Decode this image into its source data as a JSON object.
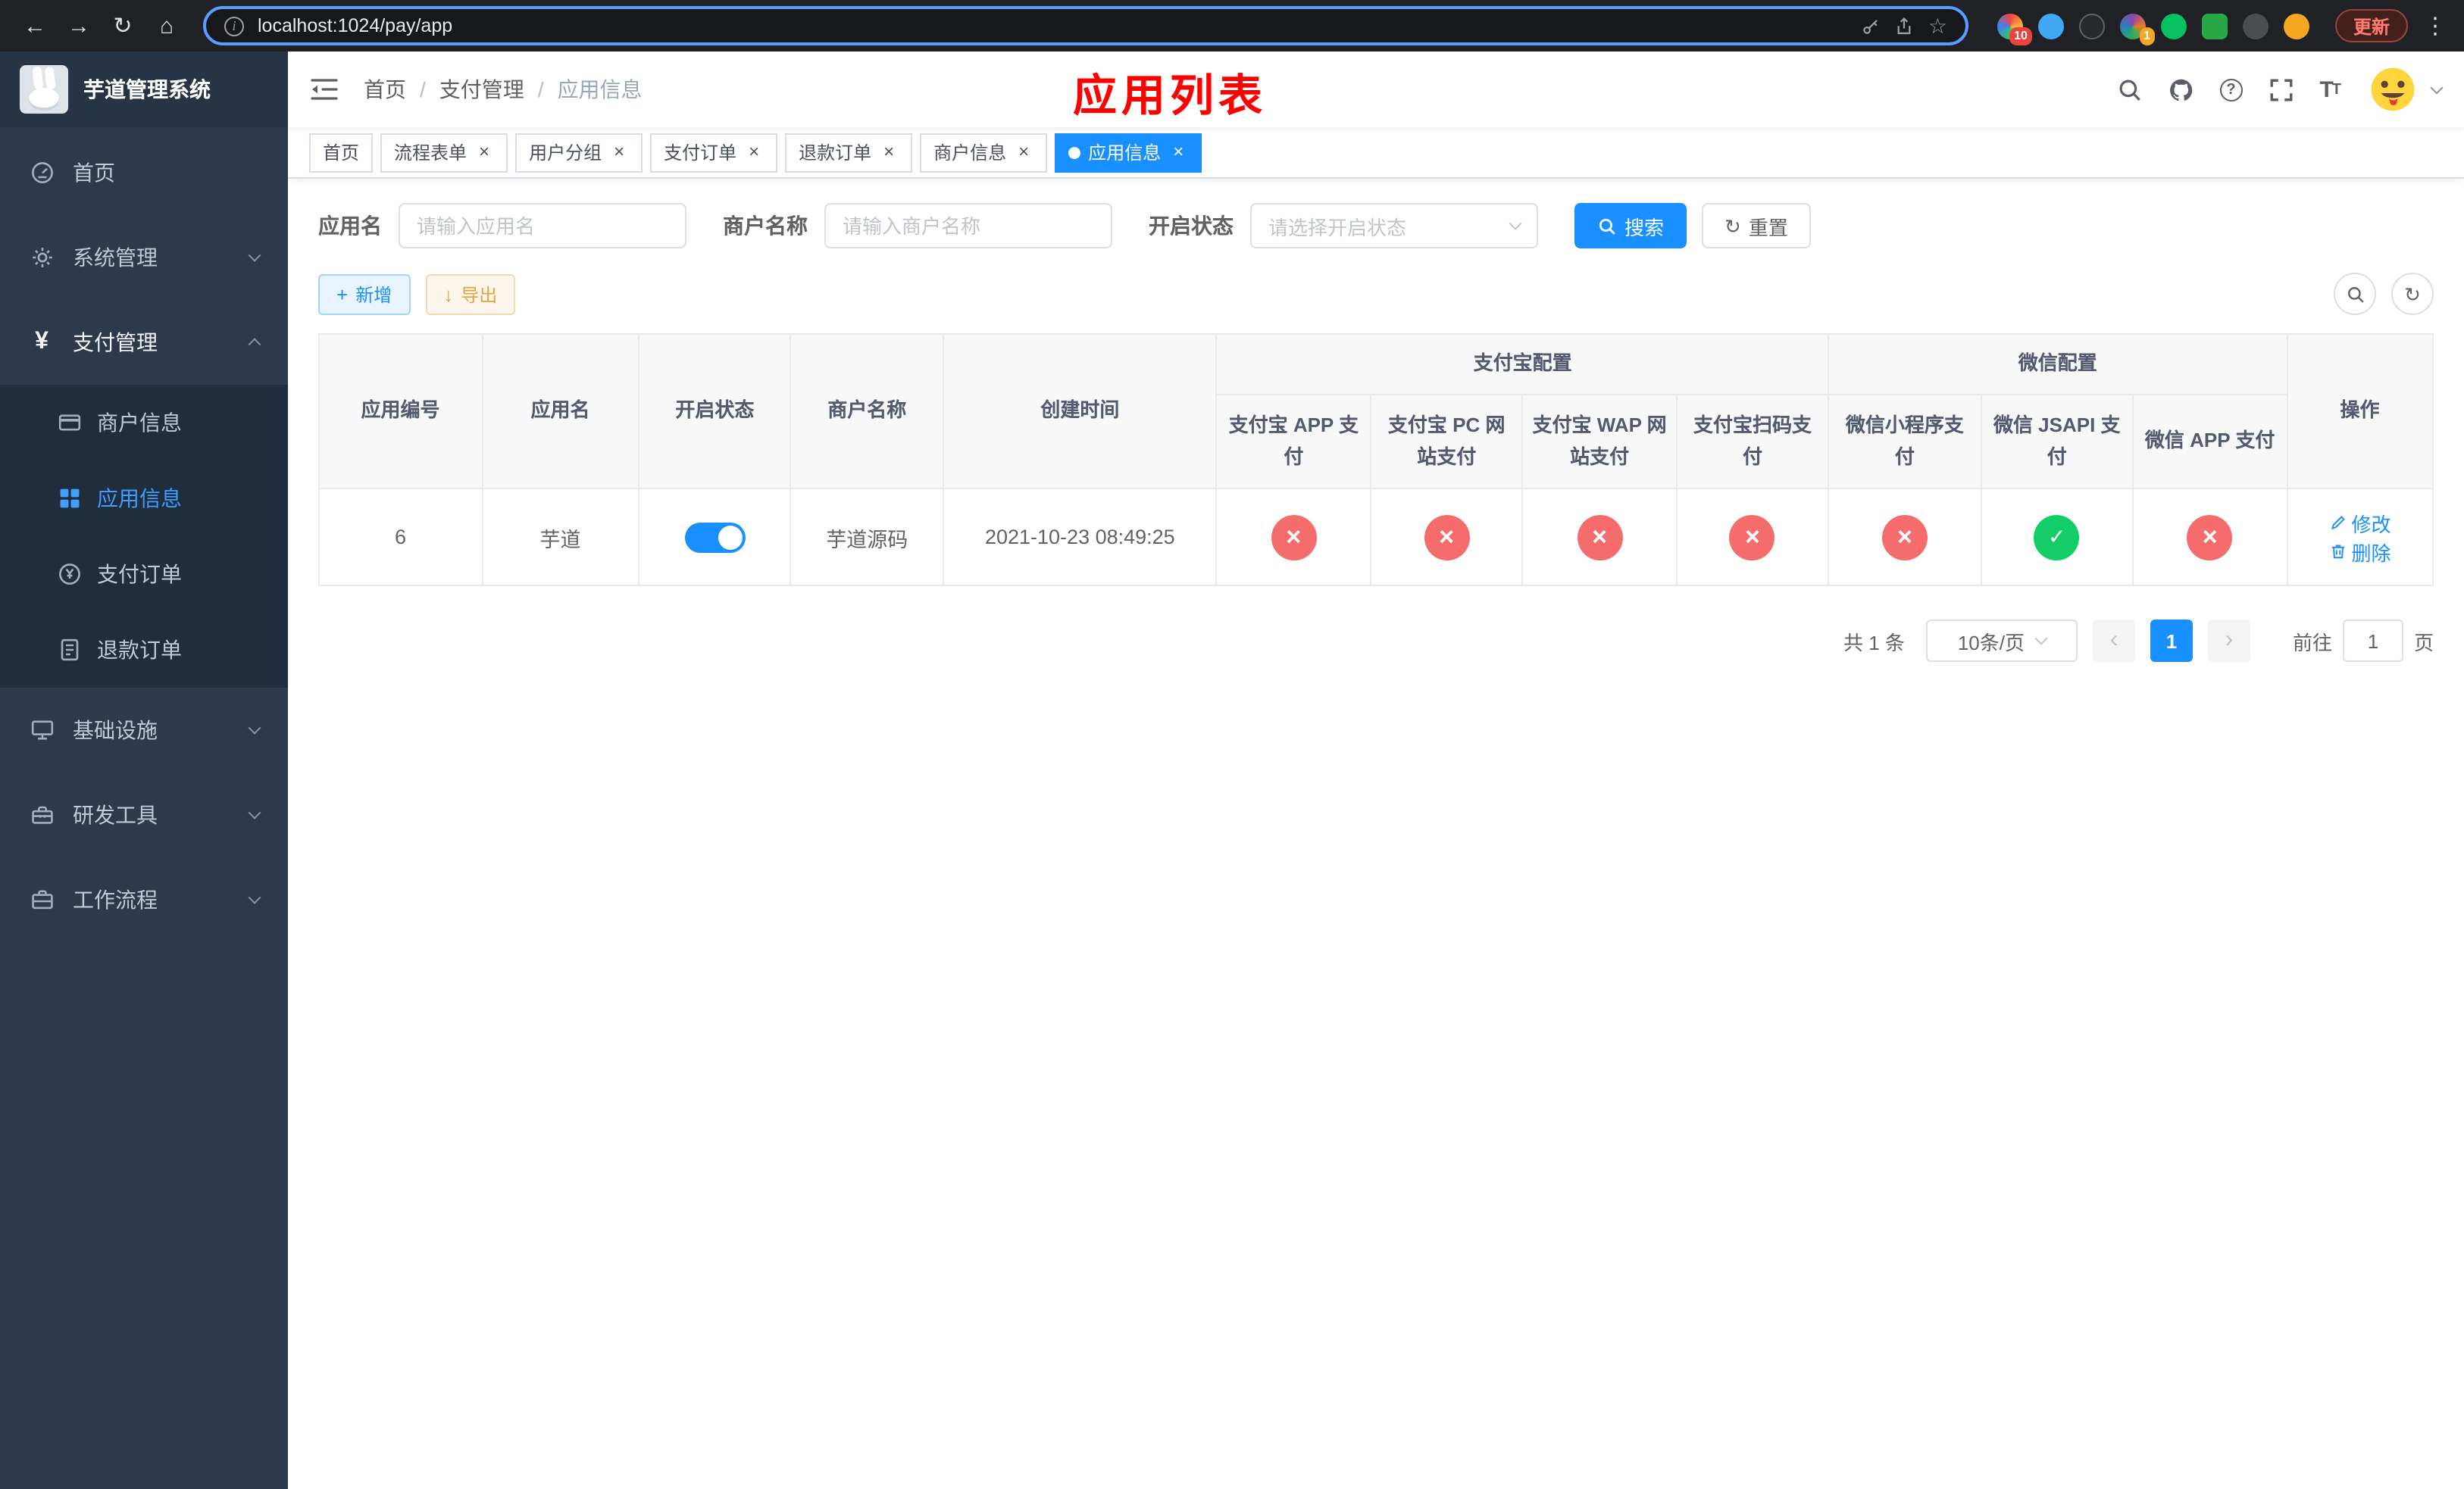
{
  "icons": {
    "back": "←",
    "forward": "→",
    "reload": "↻",
    "home": "⌂",
    "star": "☆",
    "dots": "⋮",
    "close": "×",
    "yen": "¥",
    "plus": "+",
    "download": "↓",
    "refresh": "↻",
    "prev": "‹",
    "next": "›"
  },
  "browser": {
    "url": "localhost:1024/pay/app",
    "update_label": "更新",
    "badge_count_1": "10",
    "badge_count_2": "1"
  },
  "annotation": {
    "title": "应用列表"
  },
  "sidebar": {
    "title": "芋道管理系统",
    "items": [
      {
        "label": "首页"
      },
      {
        "label": "系统管理"
      },
      {
        "label": "支付管理",
        "children": [
          {
            "label": "商户信息"
          },
          {
            "label": "应用信息"
          },
          {
            "label": "支付订单"
          },
          {
            "label": "退款订单"
          }
        ]
      },
      {
        "label": "基础设施"
      },
      {
        "label": "研发工具"
      },
      {
        "label": "工作流程"
      }
    ]
  },
  "header": {
    "breadcrumb": [
      {
        "label": "首页"
      },
      {
        "label": "支付管理"
      },
      {
        "label": "应用信息"
      }
    ]
  },
  "tabs": [
    {
      "label": "首页"
    },
    {
      "label": "流程表单"
    },
    {
      "label": "用户分组"
    },
    {
      "label": "支付订单"
    },
    {
      "label": "退款订单"
    },
    {
      "label": "商户信息"
    },
    {
      "label": "应用信息"
    }
  ],
  "filters": {
    "app_name_label": "应用名",
    "app_name_placeholder": "请输入应用名",
    "merchant_label": "商户名称",
    "merchant_placeholder": "请输入商户名称",
    "status_label": "开启状态",
    "status_placeholder": "请选择开启状态",
    "search_label": "搜索",
    "reset_label": "重置"
  },
  "toolbar": {
    "add_label": "新增",
    "export_label": "导出"
  },
  "table": {
    "headers": {
      "app_id": "应用编号",
      "app_name": "应用名",
      "status": "开启状态",
      "merchant": "商户名称",
      "created": "创建时间",
      "alipay_group": "支付宝配置",
      "wechat_group": "微信配置",
      "alipay_app": "支付宝 APP 支付",
      "alipay_pc": "支付宝 PC 网站支付",
      "alipay_wap": "支付宝 WAP 网站支付",
      "alipay_qr": "支付宝扫码支付",
      "wechat_lite": "微信小程序支付",
      "wechat_jsapi": "微信 JSAPI 支付",
      "wechat_app": "微信 APP 支付",
      "actions": "操作"
    },
    "rows": [
      {
        "app_id": "6",
        "app_name": "芋道",
        "status": "on",
        "merchant": "芋道源码",
        "created": "2021-10-23 08:49:25",
        "alipay_app": "off",
        "alipay_pc": "off",
        "alipay_wap": "off",
        "alipay_qr": "off",
        "wechat_lite": "off",
        "wechat_jsapi": "on",
        "wechat_app": "off",
        "edit_label": "修改",
        "delete_label": "删除"
      }
    ]
  },
  "pagination": {
    "total": "共 1 条",
    "page_size": "10条/页",
    "page": "1",
    "goto_label": "前往",
    "goto_value": "1",
    "page_unit": "页"
  },
  "colors": {
    "primary": "#1890ff",
    "success": "#13ce66",
    "danger": "#f56c6c",
    "sidebar_bg": "#2d3a4b",
    "submenu_bg": "#1f2d3d",
    "annotation": "#ff0000"
  }
}
